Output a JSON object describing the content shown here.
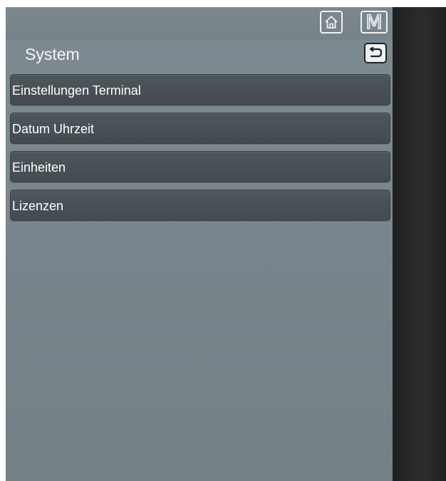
{
  "header": {
    "home_icon": "home-icon",
    "m_label": "M",
    "back_icon": "back-arrow-icon"
  },
  "page": {
    "title": "System"
  },
  "menu": {
    "items": [
      {
        "label": "Einstellungen Terminal"
      },
      {
        "label": "Datum Uhrzeit"
      },
      {
        "label": "Einheiten"
      },
      {
        "label": "Lizenzen"
      }
    ]
  },
  "colors": {
    "panel": "#7a868d",
    "menu_item": "#485055",
    "bezel": "#262828",
    "text": "#ffffff"
  }
}
